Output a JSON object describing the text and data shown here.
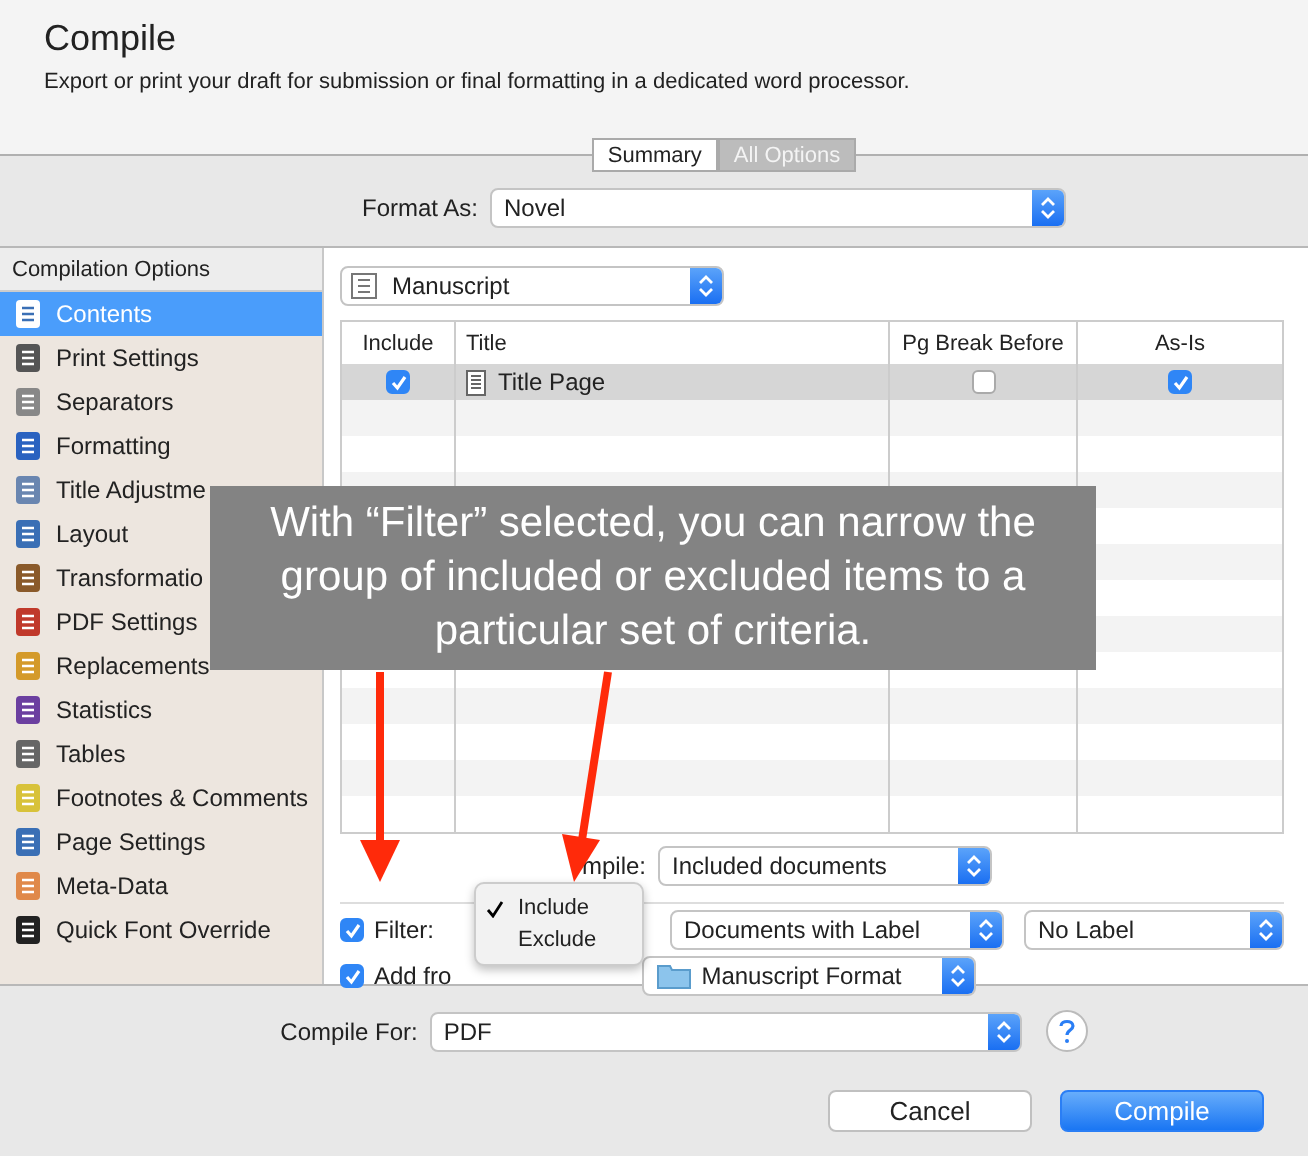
{
  "window": {
    "title": "Compile",
    "subtitle": "Export or print your draft for submission or final formatting in a dedicated word processor."
  },
  "view_tabs": [
    {
      "label": "Summary",
      "selected": false
    },
    {
      "label": "All Options",
      "selected": true
    }
  ],
  "format_as": {
    "label": "Format As:",
    "value": "Novel"
  },
  "sidebar": {
    "title": "Compilation Options",
    "items": [
      {
        "label": "Contents",
        "selected": true
      },
      {
        "label": "Print Settings",
        "selected": false
      },
      {
        "label": "Separators",
        "selected": false
      },
      {
        "label": "Formatting",
        "selected": false
      },
      {
        "label": "Title Adjustme",
        "selected": false
      },
      {
        "label": "Layout",
        "selected": false
      },
      {
        "label": "Transformatio",
        "selected": false
      },
      {
        "label": "PDF Settings",
        "selected": false
      },
      {
        "label": "Replacements",
        "selected": false
      },
      {
        "label": "Statistics",
        "selected": false
      },
      {
        "label": "Tables",
        "selected": false
      },
      {
        "label": "Footnotes & Comments",
        "selected": false
      },
      {
        "label": "Page Settings",
        "selected": false
      },
      {
        "label": "Meta-Data",
        "selected": false
      },
      {
        "label": "Quick Font Override",
        "selected": false
      }
    ]
  },
  "section_dropdown": {
    "value": "Manuscript"
  },
  "table": {
    "columns": [
      "Include",
      "Title",
      "Pg Break Before",
      "As-Is"
    ],
    "rows": [
      {
        "include": true,
        "title": "Title Page",
        "pg_break": false,
        "as_is": true,
        "selected": true
      }
    ]
  },
  "compile_row": {
    "label": "mpile:",
    "value": "Included documents"
  },
  "filter": {
    "checked": true,
    "label": "Filter:",
    "menu": [
      {
        "label": "Include",
        "checked": true
      },
      {
        "label": "Exclude",
        "checked": false
      }
    ],
    "criteria": "Documents with Label",
    "label_value": "No Label"
  },
  "add_from": {
    "checked": true,
    "label": "Add fro",
    "value": "Manuscript Format"
  },
  "compile_for": {
    "label": "Compile For:",
    "value": "PDF"
  },
  "buttons": [
    {
      "label": "Cancel",
      "kind": "default"
    },
    {
      "label": "Compile",
      "kind": "primary"
    }
  ],
  "annotation": {
    "text": "With “Filter” selected, you can narrow the group of included or excluded items to a particular set of criteria."
  }
}
